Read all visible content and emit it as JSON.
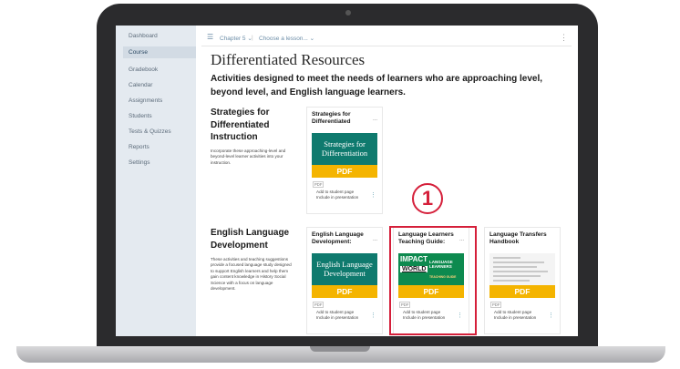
{
  "sidebar": {
    "items": [
      {
        "label": "Dashboard"
      },
      {
        "label": "Course"
      },
      {
        "label": "Gradebook"
      },
      {
        "label": "Calendar"
      },
      {
        "label": "Assignments"
      },
      {
        "label": "Students"
      },
      {
        "label": "Tests & Quizzes"
      },
      {
        "label": "Reports"
      },
      {
        "label": "Settings"
      }
    ]
  },
  "toolbar": {
    "chapter_label": "Chapter 5 ⌄",
    "lesson_label": "Choose a lesson... ⌄"
  },
  "page": {
    "title": "Differentiated Resources",
    "subtitle": "Activities designed to meet the needs of learners who are approaching level, beyond level, and English language learners."
  },
  "sections": [
    {
      "title": "Strategies for Differentiated Instruction",
      "description": "Incorporate these approaching-level and beyond-level learner activities into your instruction.",
      "cards": [
        {
          "title": "Strategies for Differentiated",
          "thumb_text": "Strategies for Differentiation",
          "pdf_label": "PDF",
          "tag": "PDF",
          "link1": "Add to student page",
          "link2": "Include in presentation"
        }
      ]
    },
    {
      "title": "English Language Development",
      "description": "These activities and teaching suggestions provide a focused language study designed to support English learners and help them gain content knowledge in History Social Science with a focus on language development.",
      "cards": [
        {
          "title": "English Language Development:",
          "thumb_text": "English Language Development",
          "pdf_label": "PDF",
          "tag": "PDF",
          "link1": "Add to student page",
          "link2": "Include in presentation"
        },
        {
          "title": "Language Learners Teaching Guide:",
          "thumb_impact": "IMPACT",
          "thumb_world": "WORLD",
          "thumb_ll": "LANGUAGE LEARNERS",
          "thumb_tg": "TEACHING GUIDE",
          "pdf_label": "PDF",
          "tag": "PDF",
          "link1": "Add to student page",
          "link2": "Include in presentation"
        },
        {
          "title": "Language Transfers Handbook",
          "pdf_label": "PDF",
          "tag": "PDF",
          "link1": "Add to student page",
          "link2": "Include in presentation"
        }
      ]
    }
  ],
  "callout": {
    "step_number": "1",
    "color": "#d51f3a"
  },
  "colors": {
    "accent_green": "#0f7a6e",
    "pdf_yellow": "#f4b400",
    "sidebar_bg": "#e4eaf0"
  }
}
